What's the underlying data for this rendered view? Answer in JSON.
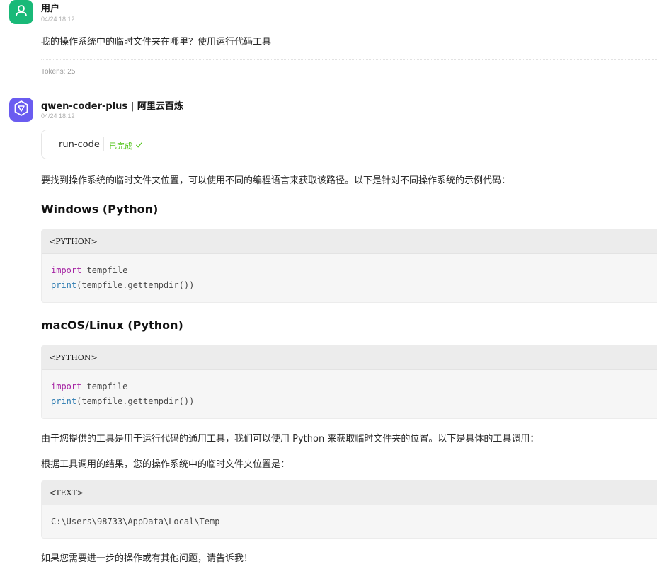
{
  "user_message": {
    "name": "用户",
    "time": "04/24 18:12",
    "text": "我的操作系统中的临时文件夹在哪里？使用运行代码工具",
    "tokens": "Tokens: 25",
    "avatar_icon": "user-icon",
    "avatar_color": "#19b978"
  },
  "assistant_message": {
    "name": "qwen-coder-plus | 阿里云百炼",
    "time": "04/24 18:12",
    "avatar_icon": "qwen-logo-icon",
    "avatar_color": "#6a5cf0",
    "tool_call": {
      "name": "run-code",
      "status": "已完成",
      "status_icon": "check-icon",
      "status_color": "#52c41a"
    },
    "intro": "要找到操作系统的临时文件夹位置，可以使用不同的编程语言来获取该路径。以下是针对不同操作系统的示例代码：",
    "sections": [
      {
        "heading": "Windows (Python)",
        "code_lang": "<PYTHON>",
        "code_lines": [
          {
            "kw": "import",
            "rest": " tempfile"
          },
          {
            "kw": "print",
            "rest": "(tempfile.gettempdir())"
          }
        ]
      },
      {
        "heading": "macOS/Linux (Python)",
        "code_lang": "<PYTHON>",
        "code_lines": [
          {
            "kw": "import",
            "rest": " tempfile"
          },
          {
            "kw": "print",
            "rest": "(tempfile.gettempdir())"
          }
        ]
      }
    ],
    "paragraph_2": "由于您提供的工具是用于运行代码的通用工具，我们可以使用 Python 来获取临时文件夹的位置。以下是具体的工具调用：",
    "paragraph_3": "根据工具调用的结果，您的操作系统中的临时文件夹位置是：",
    "result_block": {
      "code_lang": "<TEXT>",
      "text": "C:\\Users\\98733\\AppData\\Local\\Temp"
    },
    "closing": "如果您需要进一步的操作或有其他问题，请告诉我！"
  }
}
